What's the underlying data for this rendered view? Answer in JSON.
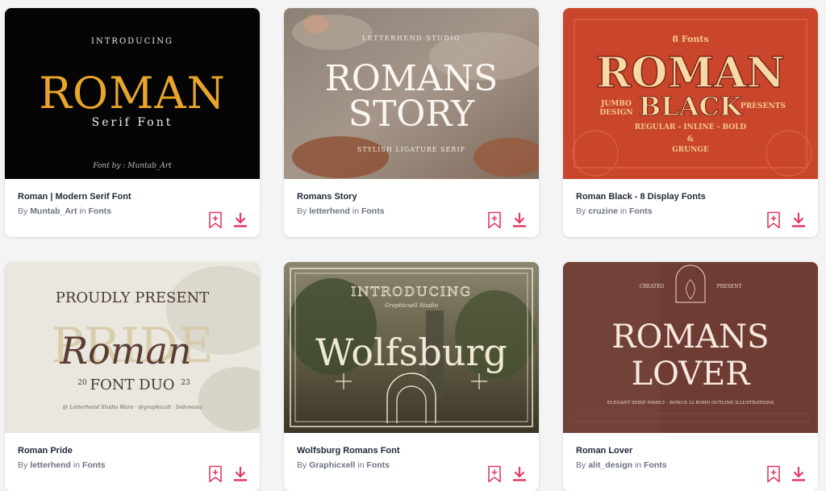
{
  "colors": {
    "accent": "#e33a63",
    "page_bg": "#f4f4f5"
  },
  "items": [
    {
      "title": "Roman | Modern Serif Font",
      "author": "Muntab_Art",
      "category": "Fonts",
      "preview": {
        "line1": "INTRODUCING",
        "line2": "ROMAN",
        "line3": "Serif Font",
        "line4": "Font by : Muntab_Art"
      }
    },
    {
      "title": "Romans Story",
      "author": "letterhend",
      "category": "Fonts",
      "preview": {
        "line1": "LETTERHEND-STUDIO",
        "line2": "ROMANS",
        "line3": "STORY",
        "line4": "STYLISH LIGATURE SERIF"
      }
    },
    {
      "title": "Roman Black - 8 Display Fonts",
      "author": "cruzine",
      "category": "Fonts",
      "preview": {
        "line1": "8 Fonts",
        "line2": "ROMAN",
        "line3": "BLACK",
        "line4": "REGULAR - INLINE - BOLD",
        "line5": "JUMBO",
        "line6": "DESIGN",
        "line7": "PRESENTS",
        "line8": "&",
        "line9": "GRUNGE"
      }
    },
    {
      "title": "Roman Pride",
      "author": "letterhend",
      "category": "Fonts",
      "preview": {
        "line1": "PROUDLY PRESENT",
        "line2": "Roman",
        "line3": "PRIDE",
        "line4": "FONT DUO",
        "line5": "20",
        "line6": "23",
        "line7": "@ Letterhend Studio Ware · @graphicalt · Indonesia"
      }
    },
    {
      "title": "Wolfsburg Romans Font",
      "author": "Graphicxell",
      "category": "Fonts",
      "preview": {
        "line1": "INTRODUCING",
        "line2": "Graphicxell Studio",
        "line3": "Wolfsburg"
      }
    },
    {
      "title": "Roman Lover",
      "author": "alit_design",
      "category": "Fonts",
      "preview": {
        "line1": "ROMANS",
        "line2": "LOVER",
        "line3": "ELEGANT SERIF FAMILY - BONUS 12 BOHO OUTLINE ILLUSTRATIONS",
        "line4": "CREATED",
        "line5": "PRESENT"
      }
    }
  ],
  "ui": {
    "by": "By",
    "in": "in"
  }
}
